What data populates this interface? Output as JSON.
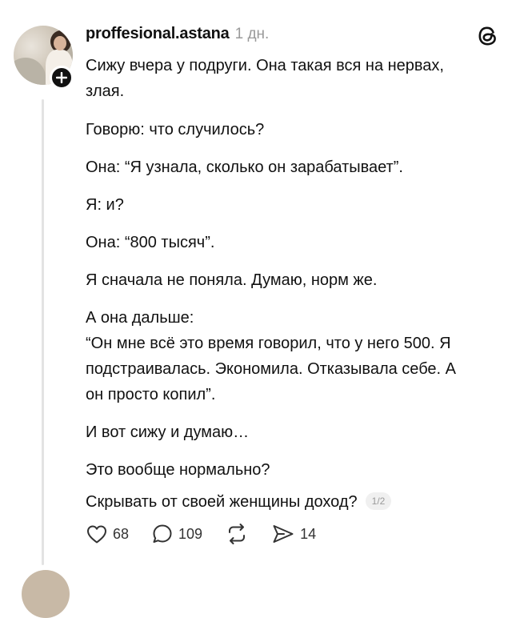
{
  "post": {
    "username": "proffesional.astana",
    "time": "1 дн.",
    "paragraphs": [
      "Сижу вчера у подруги. Она такая вся на нервах,\nзлая.",
      "Говорю: что случилось?",
      "Она: “Я узнала, сколько он зарабатывает”.",
      "Я: и?",
      "Она: “800 тысяч”.",
      "Я сначала не поняла. Думаю, норм же.",
      "А она дальше:\n“Он мне всё это время говорил, что у него 500. Я\nподстраивалась. Экономила. Отказывала себе. А\nон просто копил”.",
      "И вот сижу и думаю…",
      "Это вообще нормально?"
    ],
    "last_line": "Скрывать от своей женщины доход?",
    "page_indicator": "1/2"
  },
  "actions": {
    "likes": "68",
    "comments": "109",
    "shares": "14"
  },
  "icons": {
    "avatar": "profile-photo",
    "follow": "plus-icon",
    "app_logo": "threads-logo-icon",
    "like": "heart-icon",
    "comment": "comment-bubble-icon",
    "repost": "repost-icon",
    "share": "send-icon"
  }
}
